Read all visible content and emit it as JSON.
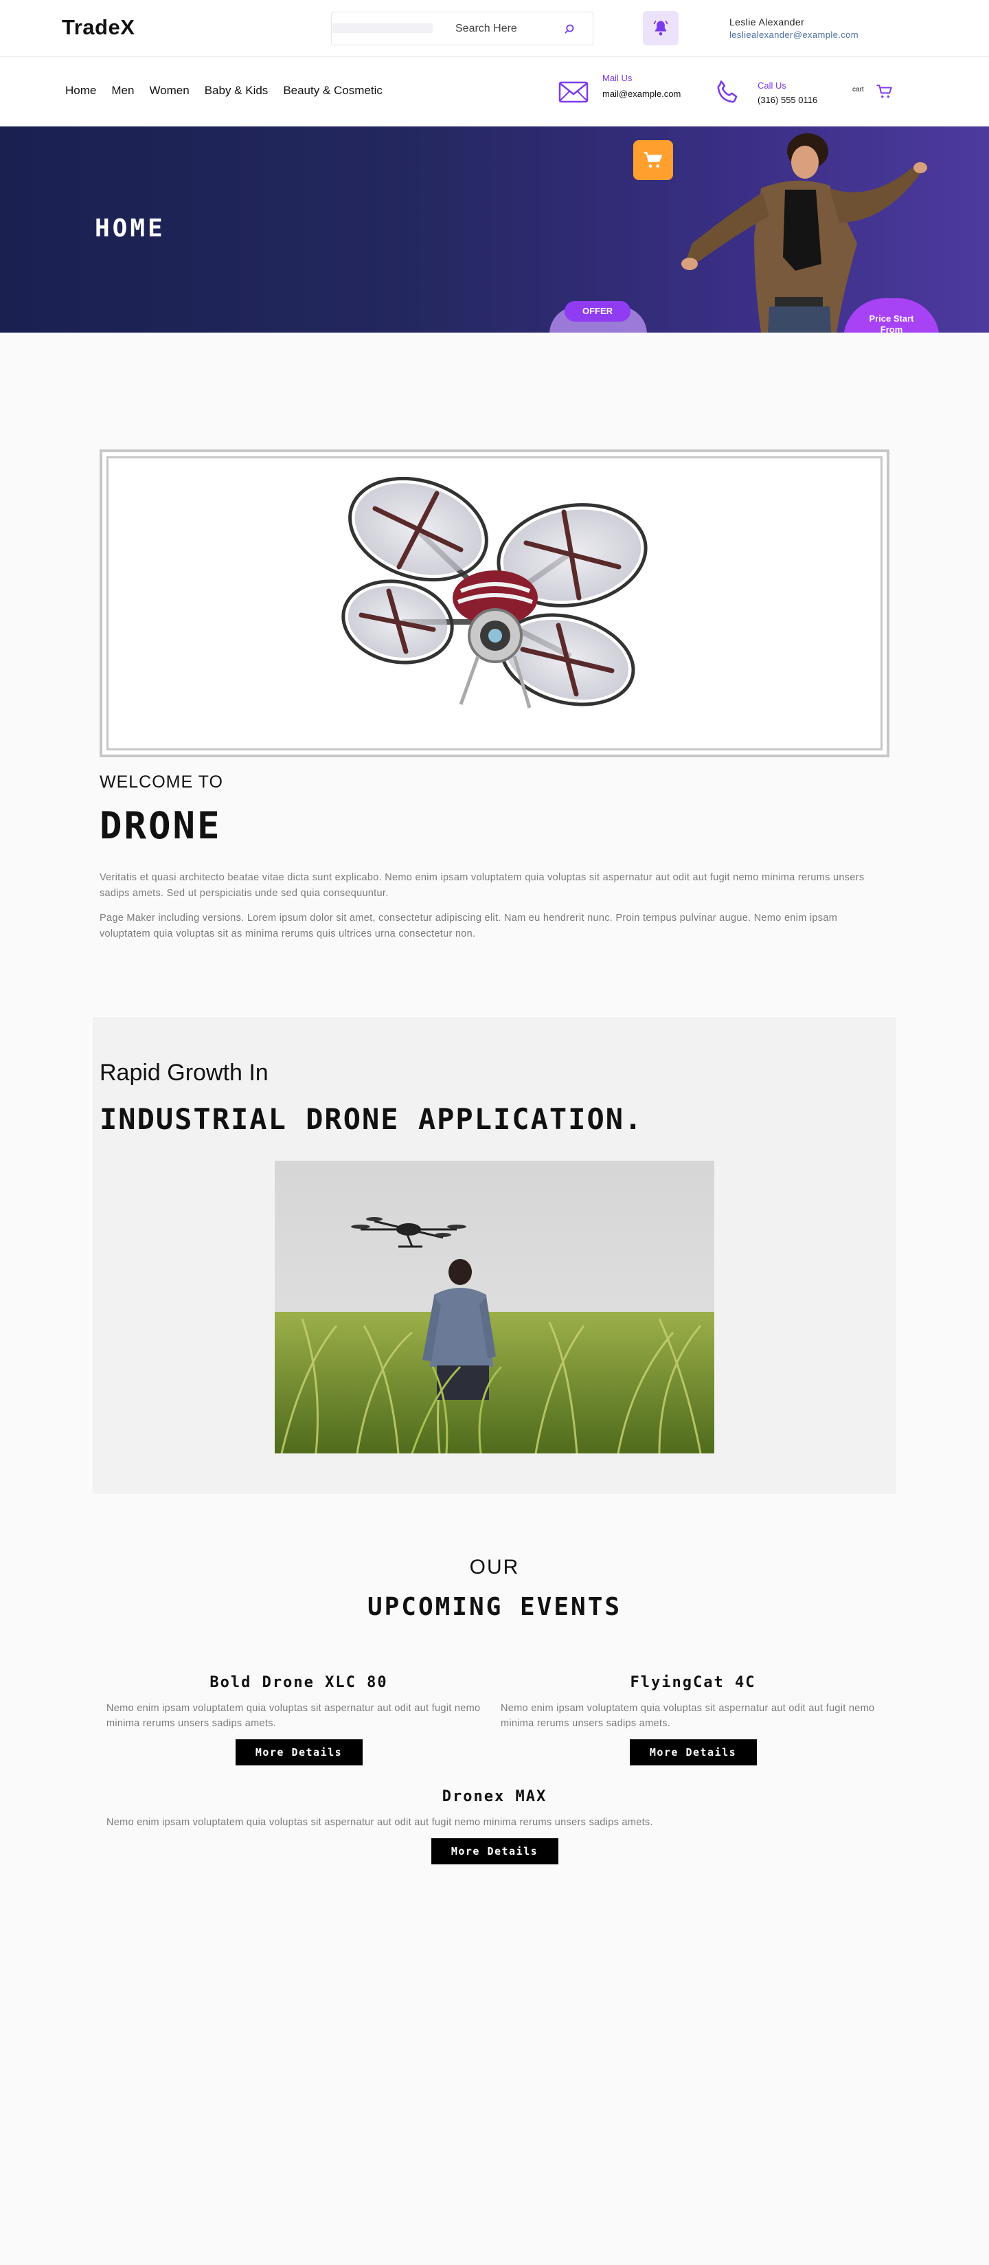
{
  "header": {
    "logo": "TradeX",
    "search": {
      "placeholder": "Search Here"
    },
    "user": {
      "name": "Leslie Alexander",
      "email": "lesliealexander@example.com"
    }
  },
  "nav": {
    "links": [
      "Home",
      "Men",
      "Women",
      "Baby & Kids",
      "Beauty & Cosmetic"
    ],
    "mail": {
      "label": "Mail Us",
      "value": "mail@example.com"
    },
    "call": {
      "label": "Call Us",
      "value": "(316) 555 0116"
    },
    "cart_count": "cart"
  },
  "hero": {
    "title": "HOME",
    "offer": "OFFER",
    "price": "Price Start From"
  },
  "drone_section": {
    "welcome": "WELCOME TO",
    "title": "DRONE",
    "paragraphs": [
      "Veritatis et quasi architecto beatae vitae dicta sunt explicabo. Nemo enim ipsam voluptatem quia voluptas sit aspernatur aut odit aut fugit nemo minima rerums unsers sadips amets. Sed ut perspiciatis unde sed quia consequuntur.",
      "Page Maker including versions. Lorem ipsum dolor sit amet, consectetur adipiscing elit. Nam eu hendrerit nunc. Proin tempus pulvinar augue. Nemo enim ipsam voluptatem quia voluptas sit as minima rerums quis ultrices urna consectetur non."
    ]
  },
  "growth_section": {
    "subtitle": "Rapid Growth In",
    "title": "INDUSTRIAL DRONE APPLICATION."
  },
  "events": {
    "our": "OUR",
    "title": "UPCOMING EVENTS",
    "items": [
      {
        "name": "Bold Drone XLC 80",
        "desc": "Nemo enim ipsam voluptatem quia voluptas sit aspernatur aut odit aut fugit nemo minima rerums unsers sadips amets.",
        "button": "More Details"
      },
      {
        "name": "FlyingCat 4C",
        "desc": "Nemo enim ipsam voluptatem quia voluptas sit aspernatur aut odit aut fugit nemo minima rerums unsers sadips amets.",
        "button": "More Details"
      },
      {
        "name": "Dronex MAX",
        "desc": "Nemo enim ipsam voluptatem quia voluptas sit aspernatur aut odit aut fugit nemo minima rerums unsers sadips amets.",
        "button": "More Details"
      }
    ]
  },
  "colors": {
    "accent_purple": "#7c3aed",
    "hero_dark": "#1a2050",
    "cart_orange": "#ff9f2e",
    "button_black": "#000000"
  },
  "icons": [
    "search-icon",
    "bell-icon",
    "mail-icon",
    "phone-icon",
    "cart-icon",
    "shopping-cart-icon"
  ]
}
